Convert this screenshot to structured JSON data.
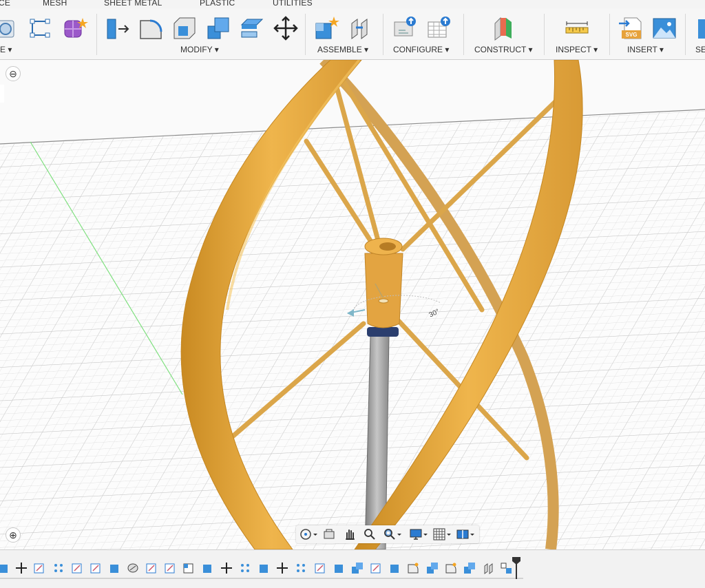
{
  "tabs": [
    "CE",
    "MESH",
    "SHEET METAL",
    "PLASTIC",
    "UTILITIES"
  ],
  "toolbar": {
    "groups": [
      "E ▾",
      "MODIFY ▾",
      "ASSEMBLE ▾",
      "CONFIGURE ▾",
      "CONSTRUCT ▾",
      "INSPECT ▾",
      "INSERT ▾",
      "SE"
    ]
  },
  "viewport": {
    "left_panel_minus": "⊖",
    "left_panel_plus": "⊕",
    "model_color": "#e8a73c",
    "gizmo_label": "30°"
  },
  "navbar": {
    "icons": [
      "orbit-icon",
      "look-at-icon",
      "pan-icon",
      "zoom-icon",
      "zoom-window-icon",
      "display-settings-icon",
      "grid-settings-icon",
      "viewports-icon"
    ]
  },
  "timeline": {
    "icons": [
      "sketch",
      "move",
      "sketch",
      "pattern",
      "sketch",
      "sketch",
      "extrude",
      "combine",
      "sketch",
      "sketch",
      "split",
      "extrude",
      "move",
      "pattern",
      "extrude",
      "move",
      "pattern",
      "sketch",
      "extrude",
      "combine",
      "sketch",
      "extrude",
      "fillet",
      "combine",
      "fillet",
      "combine",
      "joint",
      "marker"
    ]
  }
}
